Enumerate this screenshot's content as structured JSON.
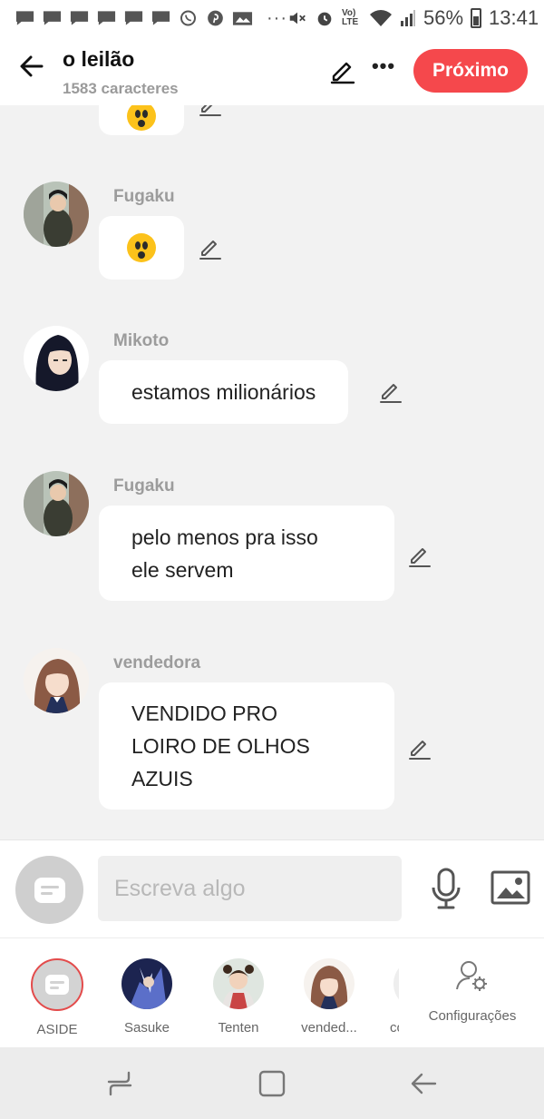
{
  "status_bar": {
    "battery_percent": "56%",
    "time": "13:41",
    "network_label": "Vo) LTE"
  },
  "header": {
    "title": "o leilão",
    "char_count": "1583 caracteres",
    "next_label": "Próximo"
  },
  "messages": [
    {
      "sender": "",
      "text": "",
      "emoji": "astonished-face"
    },
    {
      "sender": "Fugaku",
      "text": "",
      "emoji": "astonished-face"
    },
    {
      "sender": "Mikoto",
      "text": "estamos milionários"
    },
    {
      "sender": "Fugaku",
      "text_lines": [
        "pelo menos pra isso",
        "ele servem"
      ]
    },
    {
      "sender": "vendedora",
      "text_lines": [
        "VENDIDO PRO",
        "LOIRO DE OLHOS",
        "AZUIS"
      ]
    }
  ],
  "input": {
    "placeholder": "Escreva algo",
    "value": ""
  },
  "characters": [
    {
      "label": "ASIDE"
    },
    {
      "label": "Sasuke"
    },
    {
      "label": "Tenten"
    },
    {
      "label": "vended..."
    },
    {
      "label": "co"
    }
  ],
  "settings_label": "Configurações",
  "colors": {
    "accent": "#f5484c",
    "background": "#f2f2f2",
    "bubble": "#ffffff",
    "muted_text": "#9c9c9c"
  },
  "icons": {
    "back": "arrow-left-icon",
    "edit": "pencil-icon",
    "more": "more-dots-icon",
    "mic": "microphone-icon",
    "image": "image-icon",
    "settings": "user-gear-icon"
  }
}
